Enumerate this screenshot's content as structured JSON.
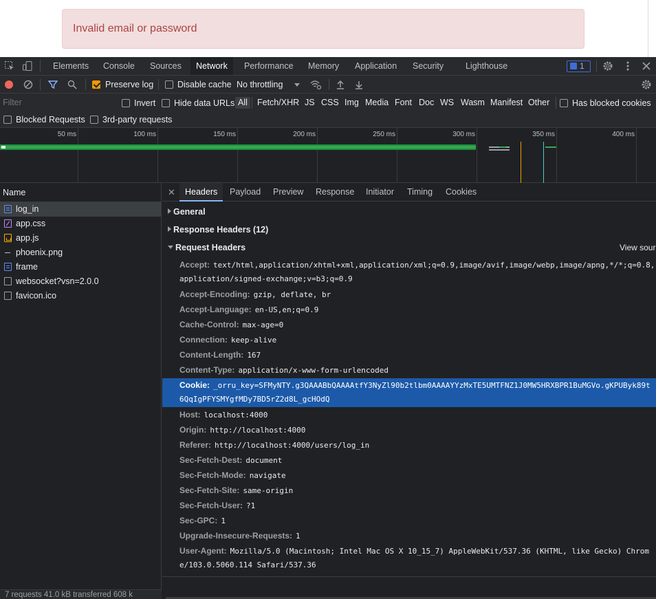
{
  "page": {
    "alert_text": "Invalid email or password"
  },
  "devtools": {
    "tabs": [
      "Elements",
      "Console",
      "Sources",
      "Network",
      "Performance",
      "Memory",
      "Application",
      "Security",
      "Lighthouse"
    ],
    "active_tab": "Network",
    "issues_count": "1"
  },
  "network_toolbar": {
    "preserve_log": "Preserve log",
    "disable_cache": "Disable cache",
    "throttling": "No throttling"
  },
  "filter_bar": {
    "placeholder": "Filter",
    "invert": "Invert",
    "hide_data_urls": "Hide data URLs",
    "types": [
      "All",
      "Fetch/XHR",
      "JS",
      "CSS",
      "Img",
      "Media",
      "Font",
      "Doc",
      "WS",
      "Wasm",
      "Manifest",
      "Other"
    ],
    "has_blocked_cookies": "Has blocked cookies",
    "blocked_requests": "Blocked Requests",
    "third_party": "3rd-party requests"
  },
  "timeline": {
    "ticks": [
      "50 ms",
      "100 ms",
      "150 ms",
      "200 ms",
      "250 ms",
      "300 ms",
      "350 ms",
      "400 ms"
    ]
  },
  "request_list": {
    "header": "Name",
    "items": [
      {
        "name": "log_in",
        "icon": "document-icon"
      },
      {
        "name": "app.css",
        "icon": "stylesheet-icon"
      },
      {
        "name": "app.js",
        "icon": "script-icon"
      },
      {
        "name": "phoenix.png",
        "icon": "image-icon"
      },
      {
        "name": "frame",
        "icon": "document-icon"
      },
      {
        "name": "websocket?vsn=2.0.0",
        "icon": "file-icon"
      },
      {
        "name": "favicon.ico",
        "icon": "file-icon"
      }
    ],
    "status": "7 requests   41.0 kB transferred   608 k"
  },
  "details": {
    "tabs": [
      "Headers",
      "Payload",
      "Preview",
      "Response",
      "Initiator",
      "Timing",
      "Cookies"
    ],
    "active_tab": "Headers",
    "general": "General",
    "response_headers": "Response Headers (12)",
    "request_headers": "Request Headers",
    "view_source": "View source",
    "headers": [
      {
        "key": "Accept:",
        "value": "text/html,application/xhtml+xml,application/xml;q=0.9,image/avif,image/webp,image/apng,*/*;q=0.8,",
        "cont": "application/signed-exchange;v=b3;q=0.9"
      },
      {
        "key": "Accept-Encoding:",
        "value": "gzip, deflate, br"
      },
      {
        "key": "Accept-Language:",
        "value": "en-US,en;q=0.9"
      },
      {
        "key": "Cache-Control:",
        "value": "max-age=0"
      },
      {
        "key": "Connection:",
        "value": "keep-alive"
      },
      {
        "key": "Content-Length:",
        "value": "167"
      },
      {
        "key": "Content-Type:",
        "value": "application/x-www-form-urlencoded"
      },
      {
        "key": "Cookie:",
        "value": "_orru_key=SFMyNTY.g3QAAABbQAAAAtfY3NyZl90b2tlbm0AAAAYYzMxTE5UMTFNZ1J0MW5HRXBPR1BuMGVo.gKPUByk89t",
        "cont": "6QqIgPFYSMYgfMDy7BD5rZ2d8L_gcHOdQ"
      },
      {
        "key": "Host:",
        "value": "localhost:4000"
      },
      {
        "key": "Origin:",
        "value": "http://localhost:4000"
      },
      {
        "key": "Referer:",
        "value": "http://localhost:4000/users/log_in"
      },
      {
        "key": "Sec-Fetch-Dest:",
        "value": "document"
      },
      {
        "key": "Sec-Fetch-Mode:",
        "value": "navigate"
      },
      {
        "key": "Sec-Fetch-Site:",
        "value": "same-origin"
      },
      {
        "key": "Sec-Fetch-User:",
        "value": "?1"
      },
      {
        "key": "Sec-GPC:",
        "value": "1"
      },
      {
        "key": "Upgrade-Insecure-Requests:",
        "value": "1"
      },
      {
        "key": "User-Agent:",
        "value": "Mozilla/5.0 (Macintosh; Intel Mac OS X 10_15_7) AppleWebKit/537.36 (KHTML, like Gecko) Chrom",
        "cont": "e/103.0.5060.114 Safari/537.36"
      }
    ]
  },
  "colors": {
    "accent": "#8ab4f8",
    "record": "#ee675c",
    "selected_row": "#1c5aa9",
    "alert_bg": "#f2dede",
    "alert_text": "#a94442"
  }
}
